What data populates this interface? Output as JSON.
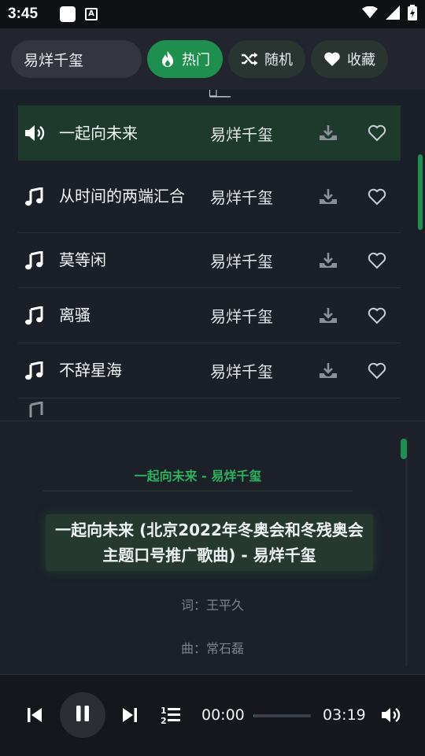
{
  "status_bar": {
    "time": "3:45",
    "a_icon": "A"
  },
  "search": {
    "value": "易烊千玺"
  },
  "tabs": [
    {
      "label": "热门",
      "icon": "fire-icon",
      "active": true
    },
    {
      "label": "随机",
      "icon": "shuffle-icon",
      "active": false
    },
    {
      "label": "收藏",
      "icon": "heart-icon",
      "active": false
    }
  ],
  "songs": [
    {
      "title": "一起向未来",
      "artist": "易烊千玺",
      "playing": true
    },
    {
      "title": "从时间的两端汇合",
      "artist": "易烊千玺",
      "playing": false
    },
    {
      "title": "莫等闲",
      "artist": "易烊千玺",
      "playing": false
    },
    {
      "title": "离骚",
      "artist": "易烊千玺",
      "playing": false
    },
    {
      "title": "不辞星海",
      "artist": "易烊千玺",
      "playing": false
    }
  ],
  "lyrics": {
    "header": "一起向未来 - 易烊千玺",
    "current": "一起向未来 (北京2022年冬奥会和冬残奥会主题口号推广歌曲) - 易烊千玺",
    "lyricist": "词：王平久",
    "composer": "曲：常石磊"
  },
  "player": {
    "current_time": "00:00",
    "total_time": "03:19",
    "progress": 0.0
  },
  "colors": {
    "accent": "#1f8f4f",
    "accent_text": "#2bb35d",
    "background": "#1b1f27"
  }
}
